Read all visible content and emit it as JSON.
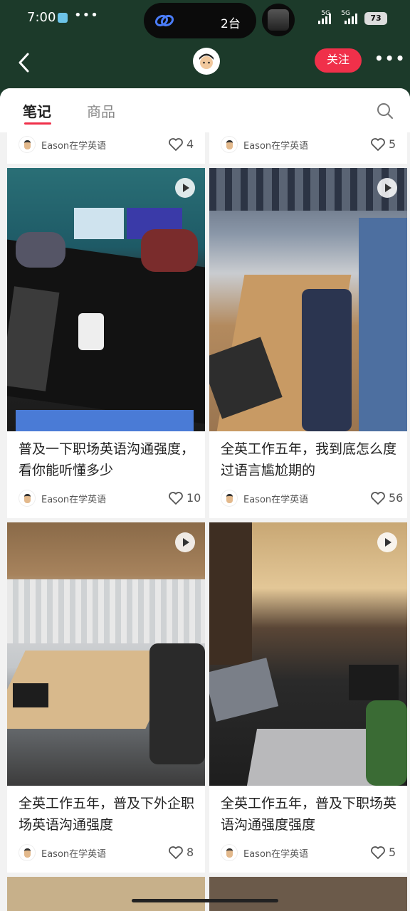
{
  "status_bar": {
    "time": "7:00",
    "dots": "•••",
    "island_count": "2台",
    "signal1": "5G",
    "signal2": "5G",
    "battery": "73"
  },
  "navbar": {
    "follow_label": "关注",
    "more_label": "•••"
  },
  "tabs": [
    {
      "label": "笔记",
      "active": true
    },
    {
      "label": "商品",
      "active": false
    }
  ],
  "top_row": [
    {
      "author": "Eason在学英语",
      "likes": "4"
    },
    {
      "author": "Eason在学英语",
      "likes": "5"
    }
  ],
  "posts": [
    {
      "title": "普及一下职场英语沟通强度，看你能听懂多少",
      "author": "Eason在学英语",
      "likes": "10",
      "video": true
    },
    {
      "title": "全英工作五年，我到底怎么度过语言尴尬期的",
      "author": "Eason在学英语",
      "likes": "56",
      "video": true
    },
    {
      "title": "全英工作五年，普及下外企职场英语沟通强度",
      "author": "Eason在学英语",
      "likes": "8",
      "video": true
    },
    {
      "title": "全英工作五年，普及下职场英语沟通强度强度",
      "author": "Eason在学英语",
      "likes": "5",
      "video": true
    }
  ],
  "colors": {
    "accent": "#f0304a",
    "header_bg": "#1c3a2a"
  }
}
